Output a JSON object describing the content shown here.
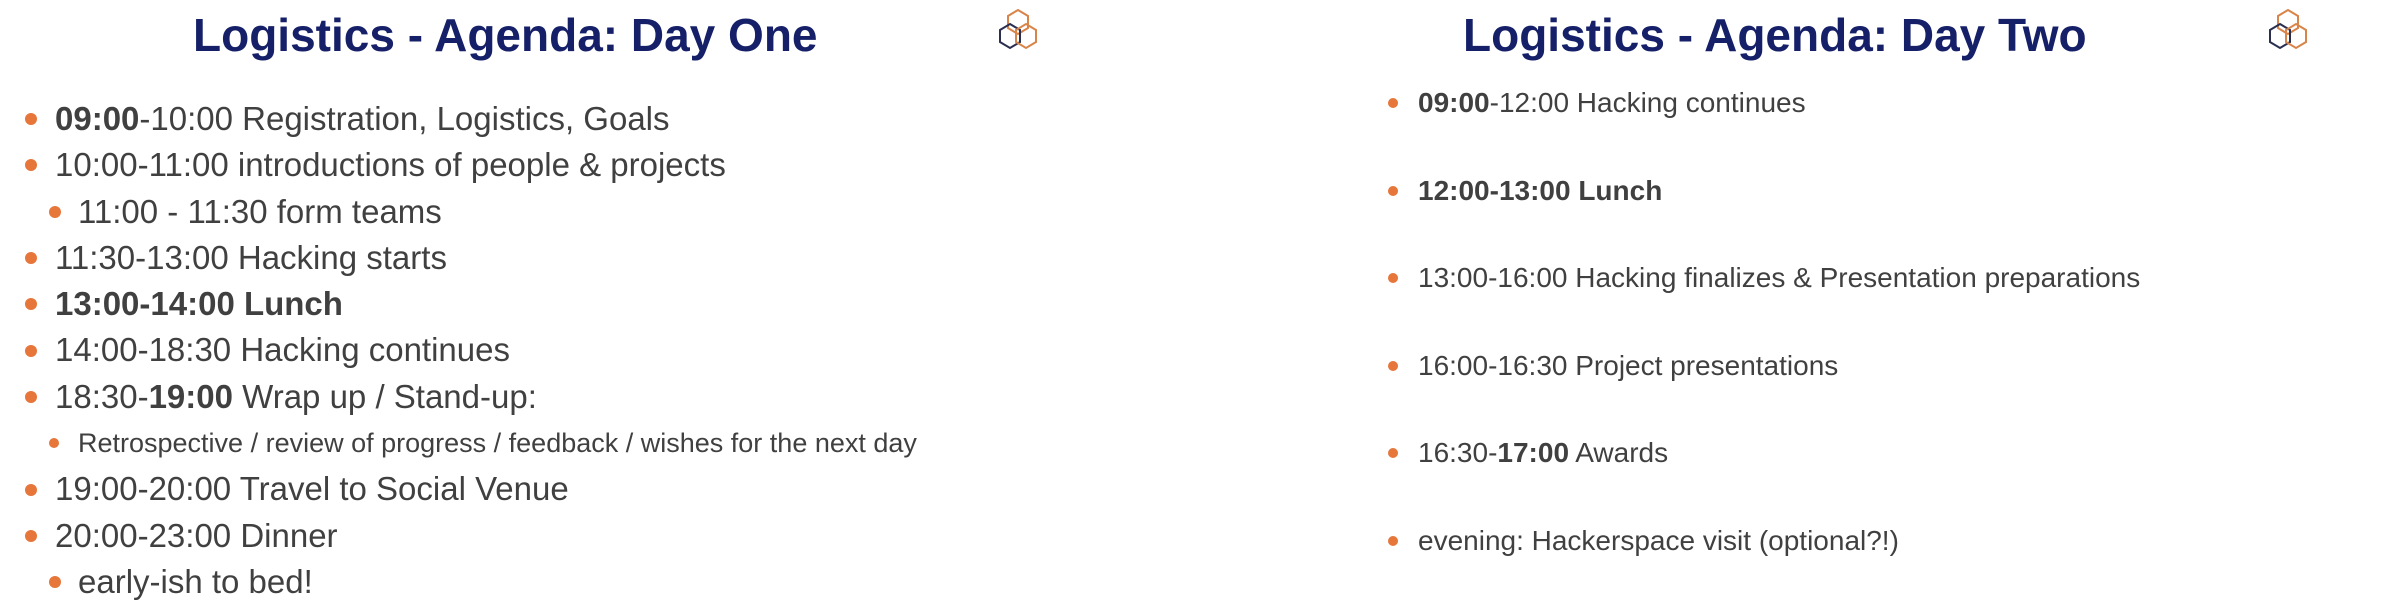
{
  "day_one": {
    "title": "Logistics - Agenda: Day One",
    "items": [
      {
        "bold": "09:00",
        "rest": "-10:00 Registration, Logistics, Goals"
      },
      {
        "pre": "10:00-11:00 introductions of people & projects"
      },
      {
        "pre": "11:00 - 11:30 form teams"
      },
      {
        "pre": "11:30-13:00 Hacking starts"
      },
      {
        "bold": "13:00-14:00 Lunch"
      },
      {
        "pre": "14:00-18:30 Hacking continues"
      },
      {
        "pre": "18:30-",
        "bold": "19:00",
        "rest": " Wrap up / Stand-up:"
      },
      {
        "pre": "Retrospective / review of progress / feedback / wishes for the next day"
      },
      {
        "pre": "19:00-20:00 Travel to Social Venue"
      },
      {
        "pre": "20:00-23:00 Dinner"
      },
      {
        "pre": "early-ish to bed!"
      }
    ]
  },
  "day_two": {
    "title": "Logistics - Agenda: Day Two",
    "items": [
      {
        "bold": "09:00",
        "rest": "-12:00 Hacking continues"
      },
      {
        "bold": "12:00-13:00 Lunch"
      },
      {
        "pre": "13:00-16:00 Hacking finalizes & Presentation preparations"
      },
      {
        "pre": "16:00-16:30 Project presentations"
      },
      {
        "pre": "16:30-",
        "bold": "17:00",
        "rest": " Awards"
      },
      {
        "pre": "evening: Hackerspace visit (optional?!)"
      }
    ]
  },
  "colors": {
    "title": "#152068",
    "bullet": "#e6763a",
    "body_text": "#404040",
    "logo_orange": "#d9854a",
    "logo_navy": "#2a2f4f"
  },
  "icons": {
    "logo": "hexagon-cluster-logo-icon"
  }
}
